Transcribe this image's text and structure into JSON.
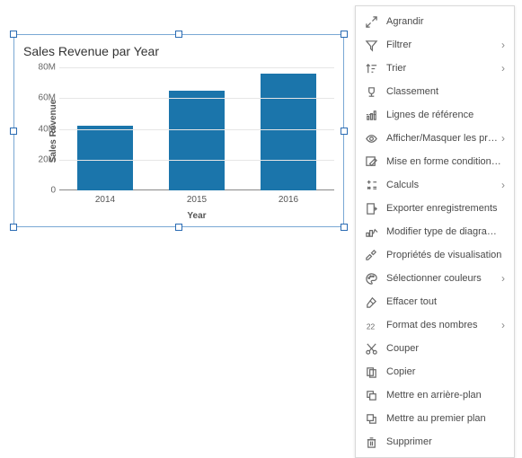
{
  "chart": {
    "title": "Sales Revenue par Year",
    "xlabel": "Year",
    "ylabel": "Sales Revenue"
  },
  "chart_data": {
    "type": "bar",
    "title": "Sales Revenue par Year",
    "xlabel": "Year",
    "ylabel": "Sales Revenue",
    "categories": [
      "2014",
      "2015",
      "2016"
    ],
    "values": [
      42000000,
      65000000,
      76000000
    ],
    "ylim": [
      0,
      80000000
    ],
    "yticks": [
      0,
      20000000,
      40000000,
      60000000,
      80000000
    ],
    "ytick_labels": [
      "0",
      "20M",
      "40M",
      "60M",
      "80M"
    ],
    "bar_color": "#1b75ab"
  },
  "menu": {
    "items": [
      {
        "icon": "expand-icon",
        "label": "Agrandir",
        "submenu": false
      },
      {
        "icon": "filter-icon",
        "label": "Filtrer",
        "submenu": true
      },
      {
        "icon": "sort-icon",
        "label": "Trier",
        "submenu": true
      },
      {
        "icon": "rank-icon",
        "label": "Classement",
        "submenu": false
      },
      {
        "icon": "refline-icon",
        "label": "Lignes de référence",
        "submenu": false
      },
      {
        "icon": "eye-icon",
        "label": "Afficher/Masquer les propriétés",
        "submenu": true
      },
      {
        "icon": "condfmt-icon",
        "label": "Mise en forme conditionnelle",
        "submenu": false
      },
      {
        "icon": "calc-icon",
        "label": "Calculs",
        "submenu": true
      },
      {
        "icon": "export-icon",
        "label": "Exporter enregistrements",
        "submenu": false
      },
      {
        "icon": "charttype-icon",
        "label": "Modifier type de diagramme",
        "submenu": false
      },
      {
        "icon": "props-icon",
        "label": "Propriétés de visualisation",
        "submenu": false
      },
      {
        "icon": "palette-icon",
        "label": "Sélectionner couleurs",
        "submenu": true
      },
      {
        "icon": "eraser-icon",
        "label": "Effacer tout",
        "submenu": false
      },
      {
        "icon": "numfmt-icon",
        "label": "Format des nombres",
        "submenu": true
      },
      {
        "icon": "cut-icon",
        "label": "Couper",
        "submenu": false
      },
      {
        "icon": "copy-icon",
        "label": "Copier",
        "submenu": false
      },
      {
        "icon": "sendback-icon",
        "label": "Mettre en arrière-plan",
        "submenu": false
      },
      {
        "icon": "bringfront-icon",
        "label": "Mettre au premier plan",
        "submenu": false
      },
      {
        "icon": "trash-icon",
        "label": "Supprimer",
        "submenu": false
      }
    ]
  }
}
